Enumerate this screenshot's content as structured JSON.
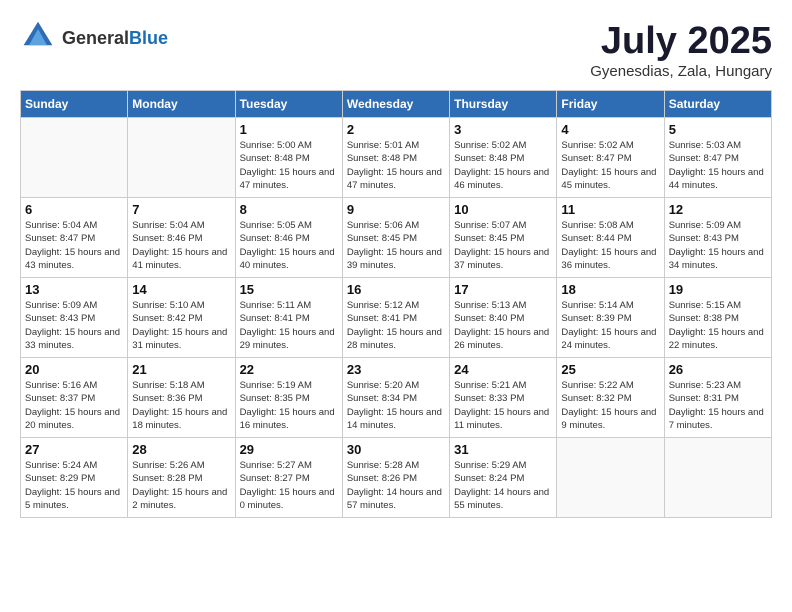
{
  "logo": {
    "general": "General",
    "blue": "Blue"
  },
  "header": {
    "title": "July 2025",
    "subtitle": "Gyenesdias, Zala, Hungary"
  },
  "weekdays": [
    "Sunday",
    "Monday",
    "Tuesday",
    "Wednesday",
    "Thursday",
    "Friday",
    "Saturday"
  ],
  "weeks": [
    [
      {
        "day": "",
        "sunrise": "",
        "sunset": "",
        "daylight": ""
      },
      {
        "day": "",
        "sunrise": "",
        "sunset": "",
        "daylight": ""
      },
      {
        "day": "1",
        "sunrise": "Sunrise: 5:00 AM",
        "sunset": "Sunset: 8:48 PM",
        "daylight": "Daylight: 15 hours and 47 minutes."
      },
      {
        "day": "2",
        "sunrise": "Sunrise: 5:01 AM",
        "sunset": "Sunset: 8:48 PM",
        "daylight": "Daylight: 15 hours and 47 minutes."
      },
      {
        "day": "3",
        "sunrise": "Sunrise: 5:02 AM",
        "sunset": "Sunset: 8:48 PM",
        "daylight": "Daylight: 15 hours and 46 minutes."
      },
      {
        "day": "4",
        "sunrise": "Sunrise: 5:02 AM",
        "sunset": "Sunset: 8:47 PM",
        "daylight": "Daylight: 15 hours and 45 minutes."
      },
      {
        "day": "5",
        "sunrise": "Sunrise: 5:03 AM",
        "sunset": "Sunset: 8:47 PM",
        "daylight": "Daylight: 15 hours and 44 minutes."
      }
    ],
    [
      {
        "day": "6",
        "sunrise": "Sunrise: 5:04 AM",
        "sunset": "Sunset: 8:47 PM",
        "daylight": "Daylight: 15 hours and 43 minutes."
      },
      {
        "day": "7",
        "sunrise": "Sunrise: 5:04 AM",
        "sunset": "Sunset: 8:46 PM",
        "daylight": "Daylight: 15 hours and 41 minutes."
      },
      {
        "day": "8",
        "sunrise": "Sunrise: 5:05 AM",
        "sunset": "Sunset: 8:46 PM",
        "daylight": "Daylight: 15 hours and 40 minutes."
      },
      {
        "day": "9",
        "sunrise": "Sunrise: 5:06 AM",
        "sunset": "Sunset: 8:45 PM",
        "daylight": "Daylight: 15 hours and 39 minutes."
      },
      {
        "day": "10",
        "sunrise": "Sunrise: 5:07 AM",
        "sunset": "Sunset: 8:45 PM",
        "daylight": "Daylight: 15 hours and 37 minutes."
      },
      {
        "day": "11",
        "sunrise": "Sunrise: 5:08 AM",
        "sunset": "Sunset: 8:44 PM",
        "daylight": "Daylight: 15 hours and 36 minutes."
      },
      {
        "day": "12",
        "sunrise": "Sunrise: 5:09 AM",
        "sunset": "Sunset: 8:43 PM",
        "daylight": "Daylight: 15 hours and 34 minutes."
      }
    ],
    [
      {
        "day": "13",
        "sunrise": "Sunrise: 5:09 AM",
        "sunset": "Sunset: 8:43 PM",
        "daylight": "Daylight: 15 hours and 33 minutes."
      },
      {
        "day": "14",
        "sunrise": "Sunrise: 5:10 AM",
        "sunset": "Sunset: 8:42 PM",
        "daylight": "Daylight: 15 hours and 31 minutes."
      },
      {
        "day": "15",
        "sunrise": "Sunrise: 5:11 AM",
        "sunset": "Sunset: 8:41 PM",
        "daylight": "Daylight: 15 hours and 29 minutes."
      },
      {
        "day": "16",
        "sunrise": "Sunrise: 5:12 AM",
        "sunset": "Sunset: 8:41 PM",
        "daylight": "Daylight: 15 hours and 28 minutes."
      },
      {
        "day": "17",
        "sunrise": "Sunrise: 5:13 AM",
        "sunset": "Sunset: 8:40 PM",
        "daylight": "Daylight: 15 hours and 26 minutes."
      },
      {
        "day": "18",
        "sunrise": "Sunrise: 5:14 AM",
        "sunset": "Sunset: 8:39 PM",
        "daylight": "Daylight: 15 hours and 24 minutes."
      },
      {
        "day": "19",
        "sunrise": "Sunrise: 5:15 AM",
        "sunset": "Sunset: 8:38 PM",
        "daylight": "Daylight: 15 hours and 22 minutes."
      }
    ],
    [
      {
        "day": "20",
        "sunrise": "Sunrise: 5:16 AM",
        "sunset": "Sunset: 8:37 PM",
        "daylight": "Daylight: 15 hours and 20 minutes."
      },
      {
        "day": "21",
        "sunrise": "Sunrise: 5:18 AM",
        "sunset": "Sunset: 8:36 PM",
        "daylight": "Daylight: 15 hours and 18 minutes."
      },
      {
        "day": "22",
        "sunrise": "Sunrise: 5:19 AM",
        "sunset": "Sunset: 8:35 PM",
        "daylight": "Daylight: 15 hours and 16 minutes."
      },
      {
        "day": "23",
        "sunrise": "Sunrise: 5:20 AM",
        "sunset": "Sunset: 8:34 PM",
        "daylight": "Daylight: 15 hours and 14 minutes."
      },
      {
        "day": "24",
        "sunrise": "Sunrise: 5:21 AM",
        "sunset": "Sunset: 8:33 PM",
        "daylight": "Daylight: 15 hours and 11 minutes."
      },
      {
        "day": "25",
        "sunrise": "Sunrise: 5:22 AM",
        "sunset": "Sunset: 8:32 PM",
        "daylight": "Daylight: 15 hours and 9 minutes."
      },
      {
        "day": "26",
        "sunrise": "Sunrise: 5:23 AM",
        "sunset": "Sunset: 8:31 PM",
        "daylight": "Daylight: 15 hours and 7 minutes."
      }
    ],
    [
      {
        "day": "27",
        "sunrise": "Sunrise: 5:24 AM",
        "sunset": "Sunset: 8:29 PM",
        "daylight": "Daylight: 15 hours and 5 minutes."
      },
      {
        "day": "28",
        "sunrise": "Sunrise: 5:26 AM",
        "sunset": "Sunset: 8:28 PM",
        "daylight": "Daylight: 15 hours and 2 minutes."
      },
      {
        "day": "29",
        "sunrise": "Sunrise: 5:27 AM",
        "sunset": "Sunset: 8:27 PM",
        "daylight": "Daylight: 15 hours and 0 minutes."
      },
      {
        "day": "30",
        "sunrise": "Sunrise: 5:28 AM",
        "sunset": "Sunset: 8:26 PM",
        "daylight": "Daylight: 14 hours and 57 minutes."
      },
      {
        "day": "31",
        "sunrise": "Sunrise: 5:29 AM",
        "sunset": "Sunset: 8:24 PM",
        "daylight": "Daylight: 14 hours and 55 minutes."
      },
      {
        "day": "",
        "sunrise": "",
        "sunset": "",
        "daylight": ""
      },
      {
        "day": "",
        "sunrise": "",
        "sunset": "",
        "daylight": ""
      }
    ]
  ]
}
